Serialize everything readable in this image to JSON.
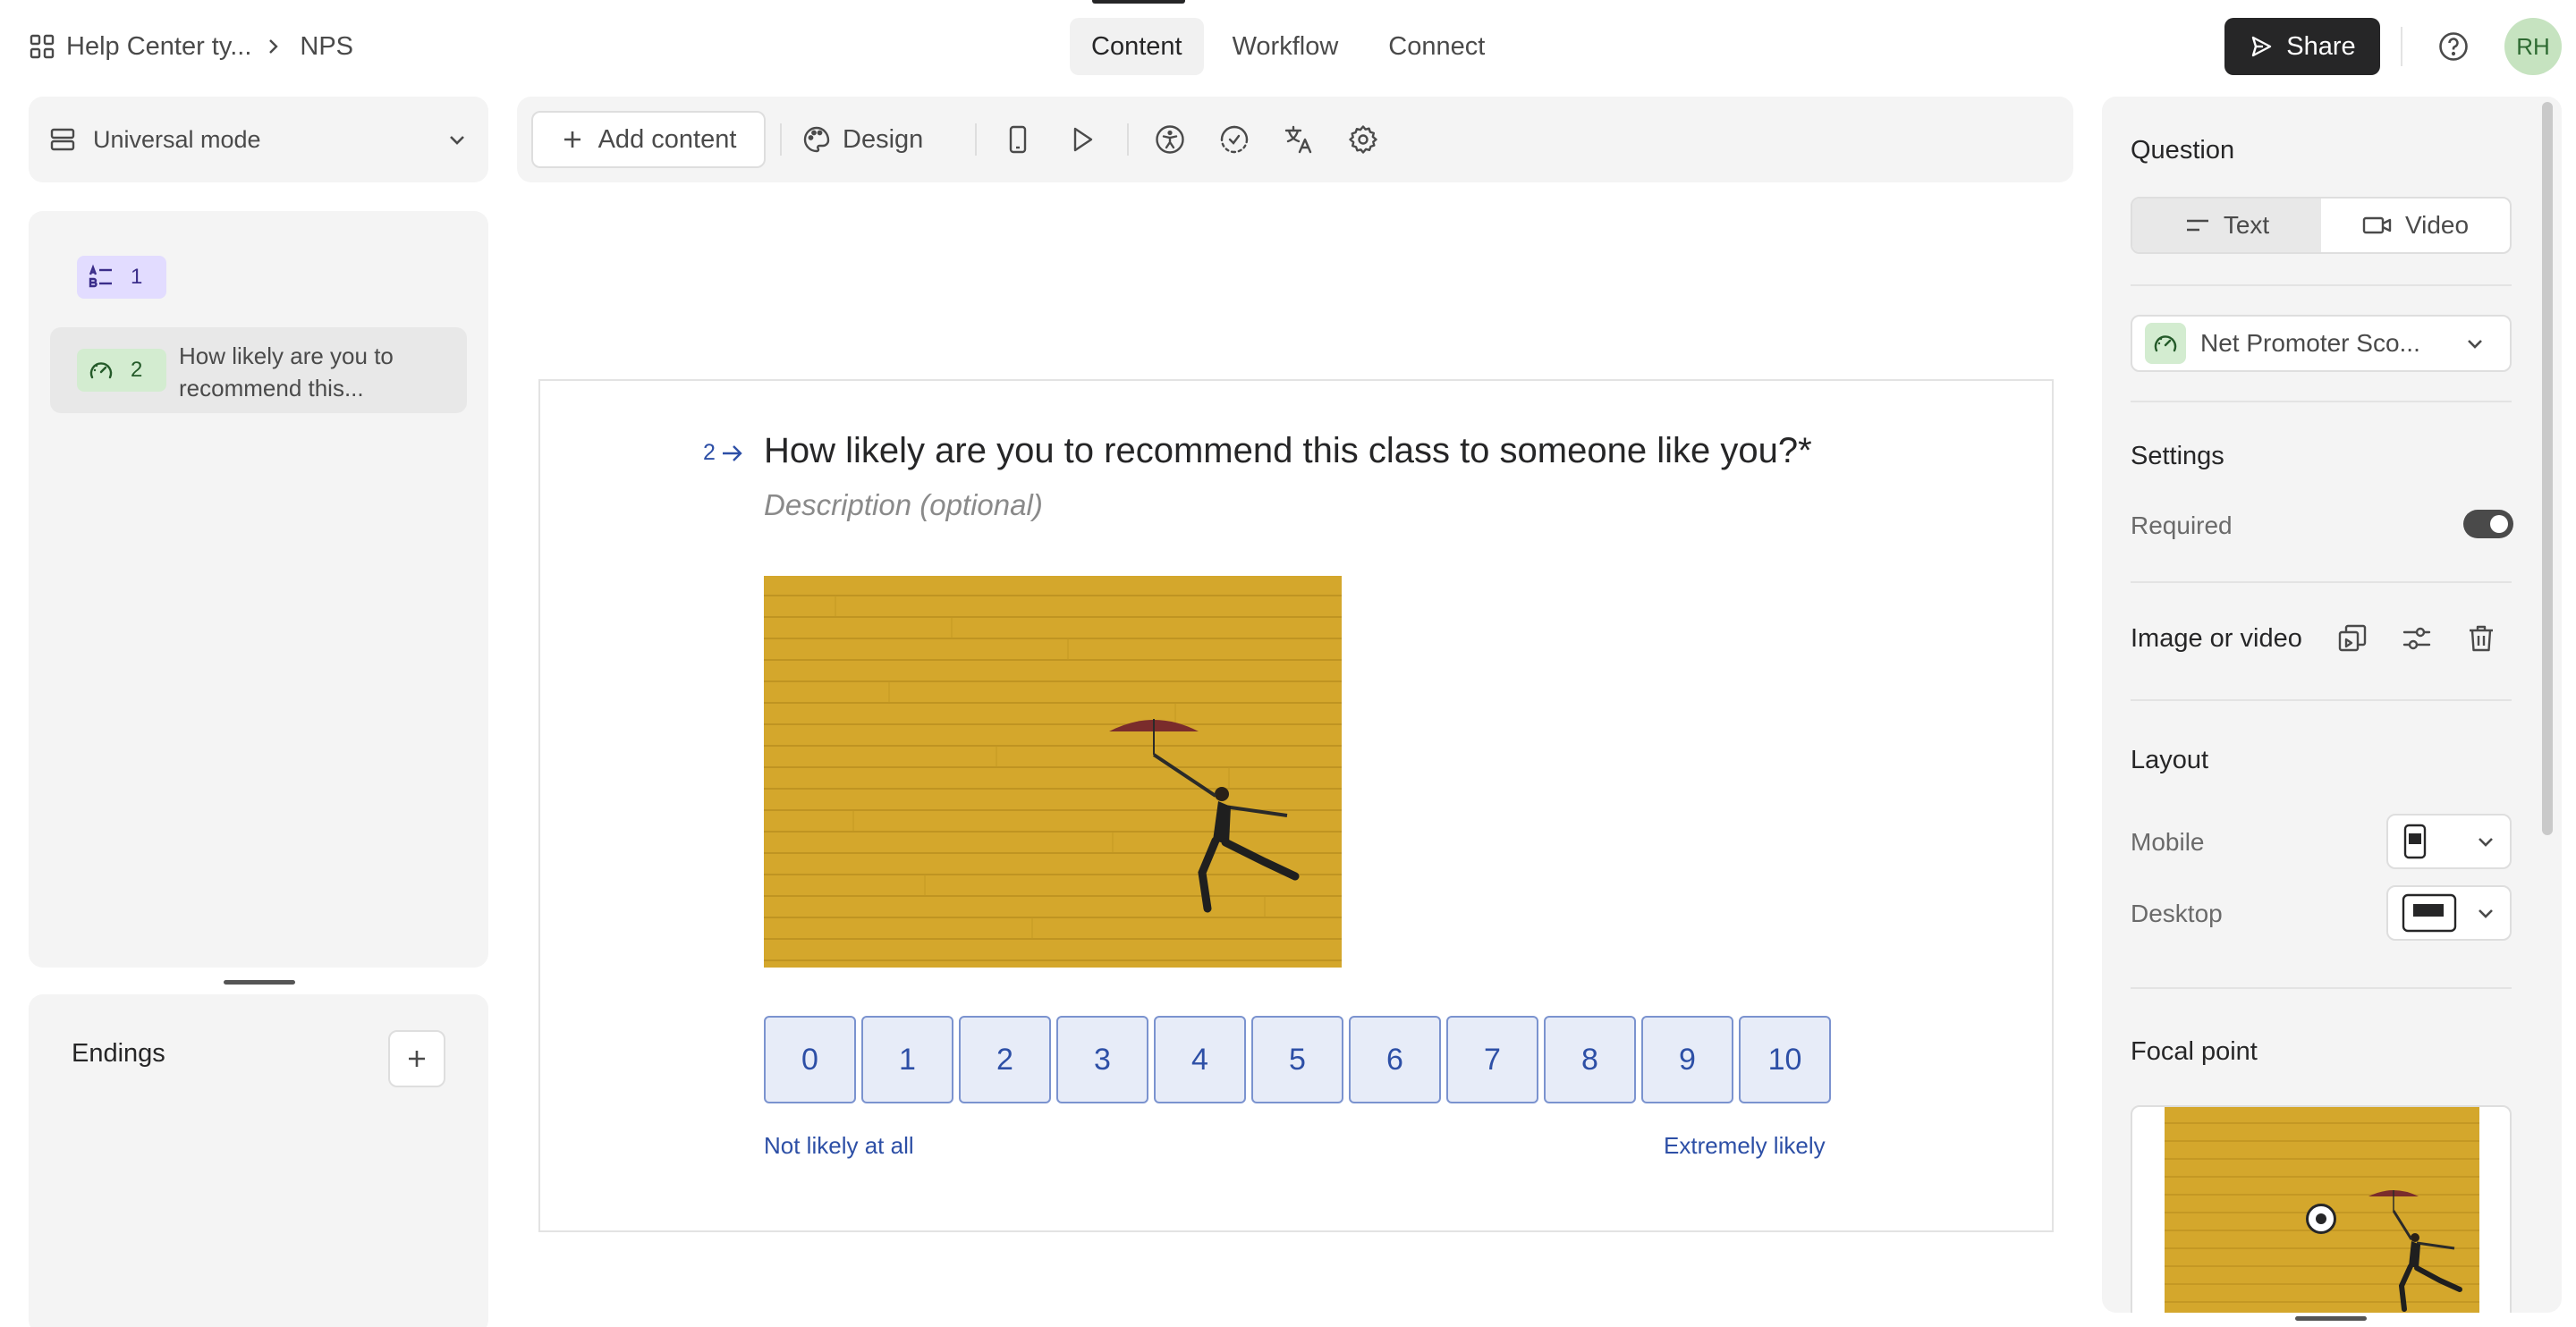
{
  "breadcrumb": {
    "workspace": "Help Center ty...",
    "form": "NPS"
  },
  "nav": {
    "tabs": [
      "Content",
      "Workflow",
      "Connect"
    ],
    "active": "Content"
  },
  "header": {
    "share_label": "Share",
    "avatar_initials": "RH"
  },
  "left": {
    "mode_label": "Universal mode",
    "questions": [
      {
        "number": "1",
        "icon": "list-icon",
        "label": ""
      },
      {
        "number": "2",
        "icon": "gauge-icon",
        "label": "How likely are you to recommend this..."
      }
    ],
    "endings_label": "Endings"
  },
  "toolbar": {
    "add_content_label": "Add content",
    "design_label": "Design"
  },
  "canvas": {
    "question_number": "2",
    "question_title": "How likely are you to recommend this class to someone like you?*",
    "description_placeholder": "Description (optional)",
    "image_alt": "Woman with umbrella leaping in front of a yellow wall",
    "scale": [
      "0",
      "1",
      "2",
      "3",
      "4",
      "5",
      "6",
      "7",
      "8",
      "9",
      "10"
    ],
    "label_left": "Not likely at all",
    "label_right": "Extremely likely"
  },
  "panel": {
    "question_heading": "Question",
    "seg_text": "Text",
    "seg_video": "Video",
    "question_type": "Net Promoter Sco...",
    "settings_heading": "Settings",
    "required_label": "Required",
    "required_on": true,
    "image_or_video_label": "Image or video",
    "layout_heading": "Layout",
    "mobile_label": "Mobile",
    "desktop_label": "Desktop",
    "focal_heading": "Focal point"
  },
  "colors": {
    "accent": "#2d4fa6",
    "scale_fill": "#e7ecf8",
    "share_bg": "#262627",
    "image_yellow": "#d4a72c"
  }
}
